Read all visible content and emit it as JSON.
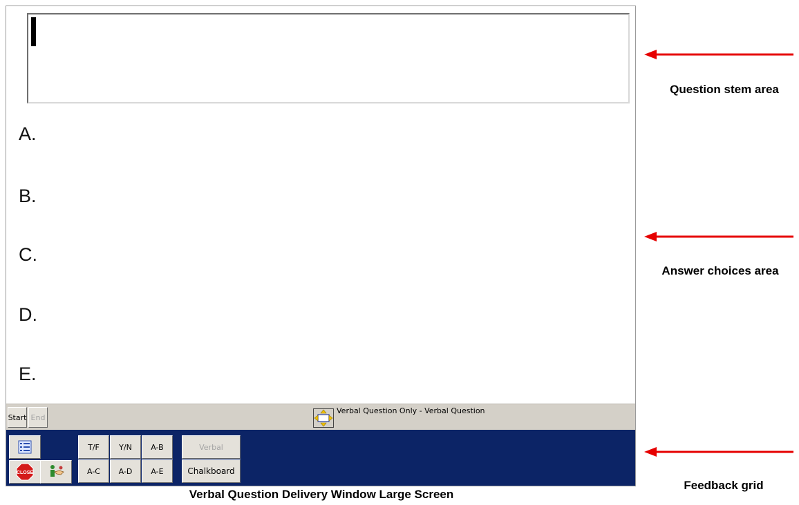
{
  "question_stem": {
    "value": ""
  },
  "choices": [
    "A.",
    "B.",
    "C.",
    "D.",
    "E."
  ],
  "status_bar": {
    "start_label": "Start",
    "end_label": "End",
    "status_text": "Verbal Question Only - Verbal Question"
  },
  "feedback_grid": {
    "close_label": "CLOSE",
    "tf_label": "T/F",
    "yn_label": "Y/N",
    "ab_label": "A-B",
    "ac_label": "A-C",
    "ad_label": "A-D",
    "ae_label": "A-E",
    "verbal_label": "Verbal",
    "chalkboard_label": "Chalkboard",
    "background_color": "#0c2466"
  },
  "annotations": {
    "question_stem": "Question stem area",
    "answer_choices": "Answer choices area",
    "feedback_grid": "Feedback grid",
    "arrow_color": "#e60000"
  },
  "caption": "Verbal Question Delivery Window Large Screen"
}
